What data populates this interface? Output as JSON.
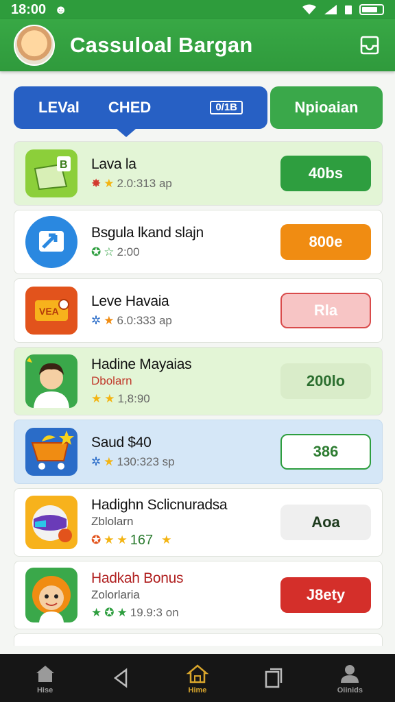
{
  "status": {
    "time": "18:00"
  },
  "app": {
    "title": "Cassuloal Bargan"
  },
  "tabs": {
    "level": "LEVal",
    "ched": "CHED",
    "badge": "0/1B",
    "side": "Npioaian"
  },
  "items": [
    {
      "name": "Lava la",
      "meta": "2.0:313 ap",
      "button": "40bs",
      "button_color": "#2e9e3f"
    },
    {
      "name": "Bsgula lkand slajn",
      "meta": "2:00",
      "button": "800e",
      "button_color": "#f08c12"
    },
    {
      "name": "Leve Havaia",
      "meta": "6.0:333 ap",
      "button": "Rla",
      "button_color": "#f7c5c5"
    },
    {
      "name": "Hadine Mayaias",
      "sub": "Dbolarn",
      "meta": "1,8:90",
      "button": "200lo",
      "button_color": "#e3f2d6"
    },
    {
      "name": "Saud $40",
      "meta": "130:323 sp",
      "button": "386",
      "button_color": "#ffffff"
    },
    {
      "name": "Hadighn Sclicnuradsa",
      "sub": "Zblolarn",
      "meta": "167",
      "button": "Aoa",
      "button_color": "#efefef"
    },
    {
      "name": "Hadkah Bonus",
      "sub": "Zolorlaria",
      "meta": "19.9:3 on",
      "button": "J8ety",
      "button_color": "#d42f2a"
    }
  ],
  "nav": [
    {
      "label": "Hise",
      "icon": "home-icon"
    },
    {
      "label": "",
      "icon": "back-triangle-icon"
    },
    {
      "label": "Hime",
      "icon": "home-outline-icon"
    },
    {
      "label": "",
      "icon": "recents-icon"
    },
    {
      "label": "Oiinids",
      "icon": "profile-icon"
    }
  ]
}
